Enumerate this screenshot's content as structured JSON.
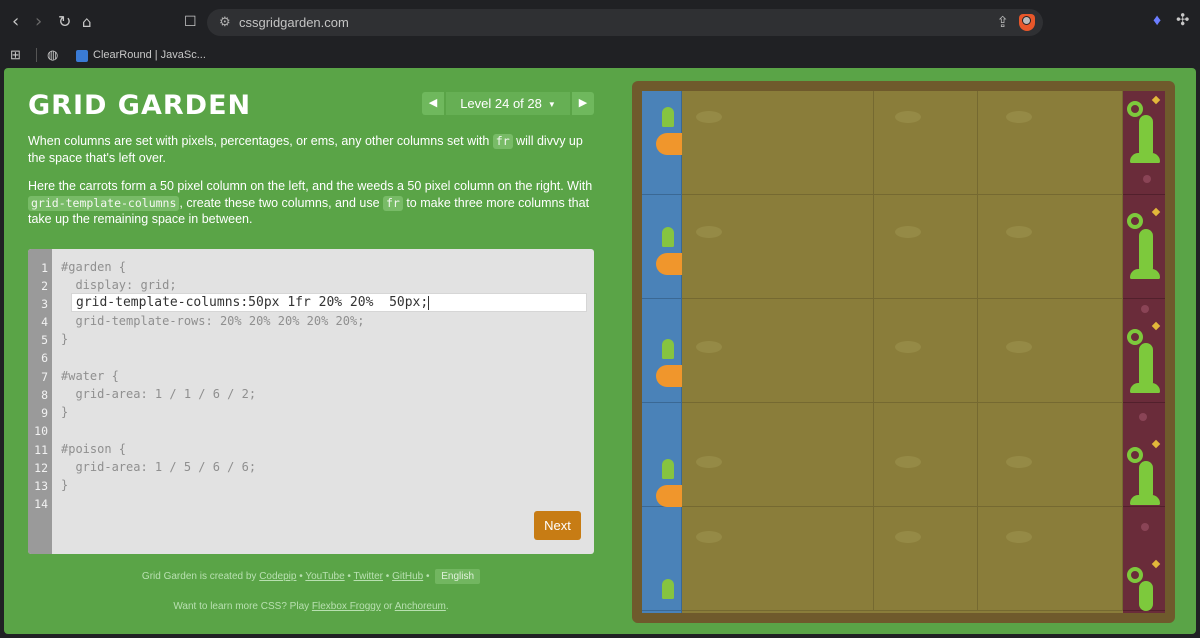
{
  "browser": {
    "url": "cssgridgarden.com",
    "bookmark_label": "ClearRound | JavaSc..."
  },
  "header": {
    "title": "GRID GARDEN",
    "level_label": "Level 24 of 28"
  },
  "instructions": {
    "p1_before": "When columns are set with pixels, percentages, or ems, any other columns set with ",
    "p1_code": "fr",
    "p1_after": " will divvy up the space that's left over.",
    "p2_before": "Here the carrots form a 50 pixel column on the left, and the weeds a 50 pixel column on the right. With ",
    "p2_code1": "grid-template-columns",
    "p2_mid": ", create these two columns, and use ",
    "p2_code2": "fr",
    "p2_after": " to make three more columns that take up the remaining space in between."
  },
  "editor": {
    "line_numbers": [
      "1",
      "2",
      "3",
      "4",
      "5",
      "6",
      "7",
      "8",
      "9",
      "10",
      "11",
      "12",
      "13",
      "14"
    ],
    "lines": {
      "l1": "#garden {",
      "l2": "  display: grid;",
      "l4": "  grid-template-rows: 20% 20% 20% 20% 20%;",
      "l5": "}",
      "l7": "#water {",
      "l8": "  grid-area: 1 / 1 / 6 / 2;",
      "l9": "}",
      "l11": "#poison {",
      "l12": "  grid-area: 1 / 5 / 6 / 6;",
      "l13": "}"
    },
    "input_value": "grid-template-columns:50px 1fr 20% 20%  50px;",
    "next_label": "Next"
  },
  "footer": {
    "credit_prefix": "Grid Garden is created by",
    "codepip": "Codepip",
    "youtube": "YouTube",
    "twitter": "Twitter",
    "github": "GitHub",
    "language": "English",
    "learn_prefix": "Want to learn more CSS? Play",
    "flexbox": "Flexbox Froggy",
    "or": "or",
    "anchoreum": "Anchoreum",
    "period": "."
  },
  "colors": {
    "page_bg": "#5aa447",
    "next_button": "#c77c14",
    "water": "#4a82b8",
    "poison": "#6a2c3a",
    "soil": "#8a7d3a"
  }
}
